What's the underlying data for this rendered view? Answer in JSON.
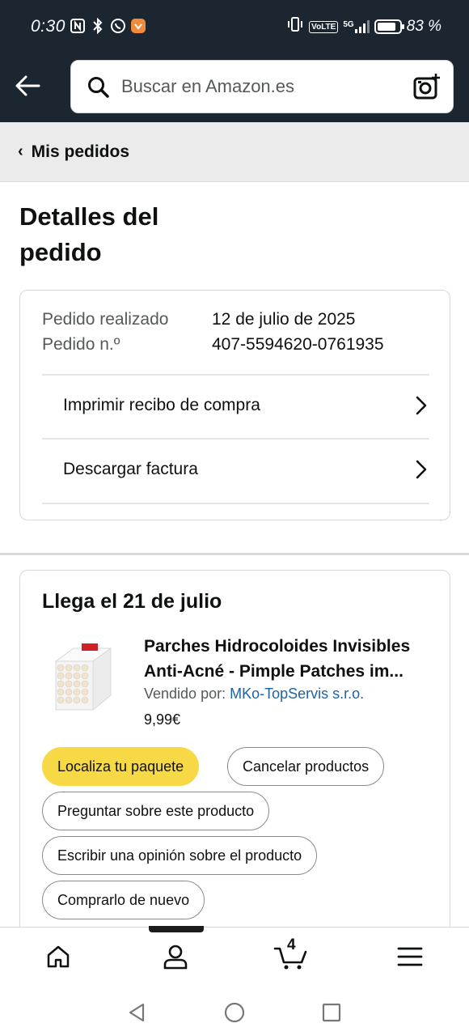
{
  "status_bar": {
    "time": "0:30",
    "network": "5G",
    "volte": "VoLTE",
    "battery_percent": "83 %",
    "battery_level": 0.83
  },
  "search": {
    "placeholder": "Buscar en Amazon.es"
  },
  "breadcrumb": {
    "label": "Mis pedidos"
  },
  "page": {
    "title": "Detalles del pedido"
  },
  "order_summary": {
    "placed_label": "Pedido realizado",
    "placed_value": "12 de julio de 2025",
    "number_label": "Pedido n.º",
    "number_value": "407-5594620-0761935",
    "actions": [
      {
        "label": "Imprimir recibo de compra"
      },
      {
        "label": "Descargar factura"
      }
    ]
  },
  "shipment": {
    "delivery": "Llega el 21 de julio",
    "product": {
      "title_line1": "Parches Hidrocoloides Invisibles",
      "title_line2": "Anti-Acné - Pimple Patches im...",
      "seller_prefix": "Vendido por:",
      "seller_name": "MKo-TopServis s.r.o.",
      "price": "9,99€"
    },
    "buttons": {
      "track": "Localiza tu paquete",
      "cancel": "Cancelar productos",
      "ask": "Preguntar sobre este producto",
      "review": "Escribir una opinión sobre el producto",
      "buy_again": "Comprarlo de nuevo"
    }
  },
  "bottom_nav": {
    "cart_count": "4",
    "items": [
      "home-icon",
      "account-icon",
      "cart-icon",
      "menu-icon"
    ]
  },
  "colors": {
    "header_bg": "#1c2631",
    "primary_button": "#f7d945",
    "link": "#2162a1"
  }
}
